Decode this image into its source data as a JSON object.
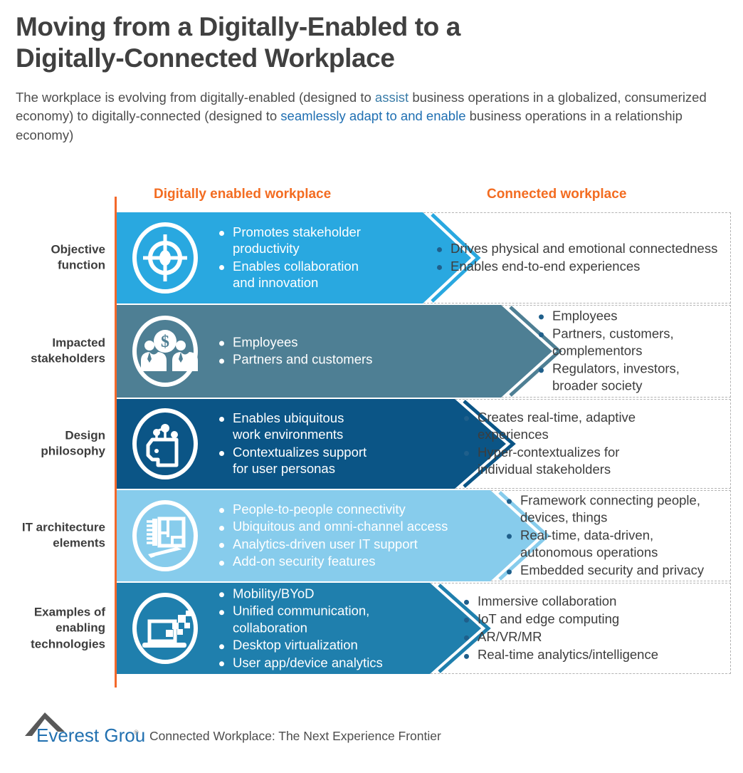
{
  "header": {
    "title": "Moving from a Digitally-Enabled to a\nDigitally-Connected Workplace",
    "subtitle_parts": {
      "p1": "The workplace is evolving from digitally-enabled (designed to ",
      "hl1": "assist",
      "p2": " business operations in a globalized, consumerized economy) to digitally-connected (designed to ",
      "hl2": "seamlessly adapt to and enable",
      "p3": " business operations in a relationship economy)"
    }
  },
  "columns": {
    "left_heading": "Digitally enabled workplace",
    "right_heading": "Connected workplace"
  },
  "colors": {
    "accent_orange": "#f36c21",
    "row1": "#29a8e0",
    "row2": "#4e7f94",
    "row3": "#0b5586",
    "row4": "#87ccec",
    "row5": "#1f7fad",
    "bullet_blue": "#1f5f8b",
    "link_blue": "#3a7ca8"
  },
  "rows": [
    {
      "label": "Objective\nfunction",
      "icon": "target-crosshair-icon",
      "color": "#29a8e0",
      "left_bullets": [
        "Promotes stakeholder\nproductivity",
        "Enables collaboration\nand innovation"
      ],
      "right_bullets": [
        "Drives physical and emotional connectedness",
        "Enables end-to-end experiences"
      ]
    },
    {
      "label": "Impacted\nstakeholders",
      "icon": "stakeholders-dollar-icon",
      "color": "#4e7f94",
      "left_bullets": [
        "Employees",
        "Partners and customers"
      ],
      "right_bullets": [
        "Employees",
        "Partners, customers,\ncomplementors",
        "Regulators, investors,\nbroader society"
      ]
    },
    {
      "label": "Design\nphilosophy",
      "icon": "head-ai-nodes-icon",
      "color": "#0b5586",
      "left_bullets": [
        "Enables ubiquitous\nwork environments",
        "Contextualizes support\nfor user personas"
      ],
      "right_bullets": [
        "Creates real-time, adaptive\nexperiences",
        "Hyper-contextualizes for\nindividual stakeholders"
      ]
    },
    {
      "label": "IT architecture\nelements",
      "icon": "blueprint-pencil-icon",
      "color": "#87ccec",
      "left_bullets": [
        "People-to-people connectivity",
        "Ubiquitous and omni-channel access",
        "Analytics-driven user IT support",
        "Add-on security features"
      ],
      "right_bullets": [
        "Framework connecting people,\ndevices, things",
        "Real-time, data-driven,\nautonomous operations",
        "Embedded security and privacy"
      ]
    },
    {
      "label": "Examples of\nenabling\ntechnologies",
      "icon": "laptop-digital-tiles-icon",
      "color": "#1f7fad",
      "left_bullets": [
        "Mobility/BYoD",
        "Unified communication,\ncollaboration",
        "Desktop virtualization",
        "User app/device analytics"
      ],
      "right_bullets": [
        "Immersive collaboration",
        "IoT and edge computing",
        "AR/VR/MR",
        "Real-time analytics/intelligence"
      ]
    }
  ],
  "footer": {
    "logo_text": "Everest Group",
    "logo_mark": "mountain-peak-icon",
    "registered_mark": "®",
    "caption": "Connected Workplace: The Next Experience Frontier"
  }
}
